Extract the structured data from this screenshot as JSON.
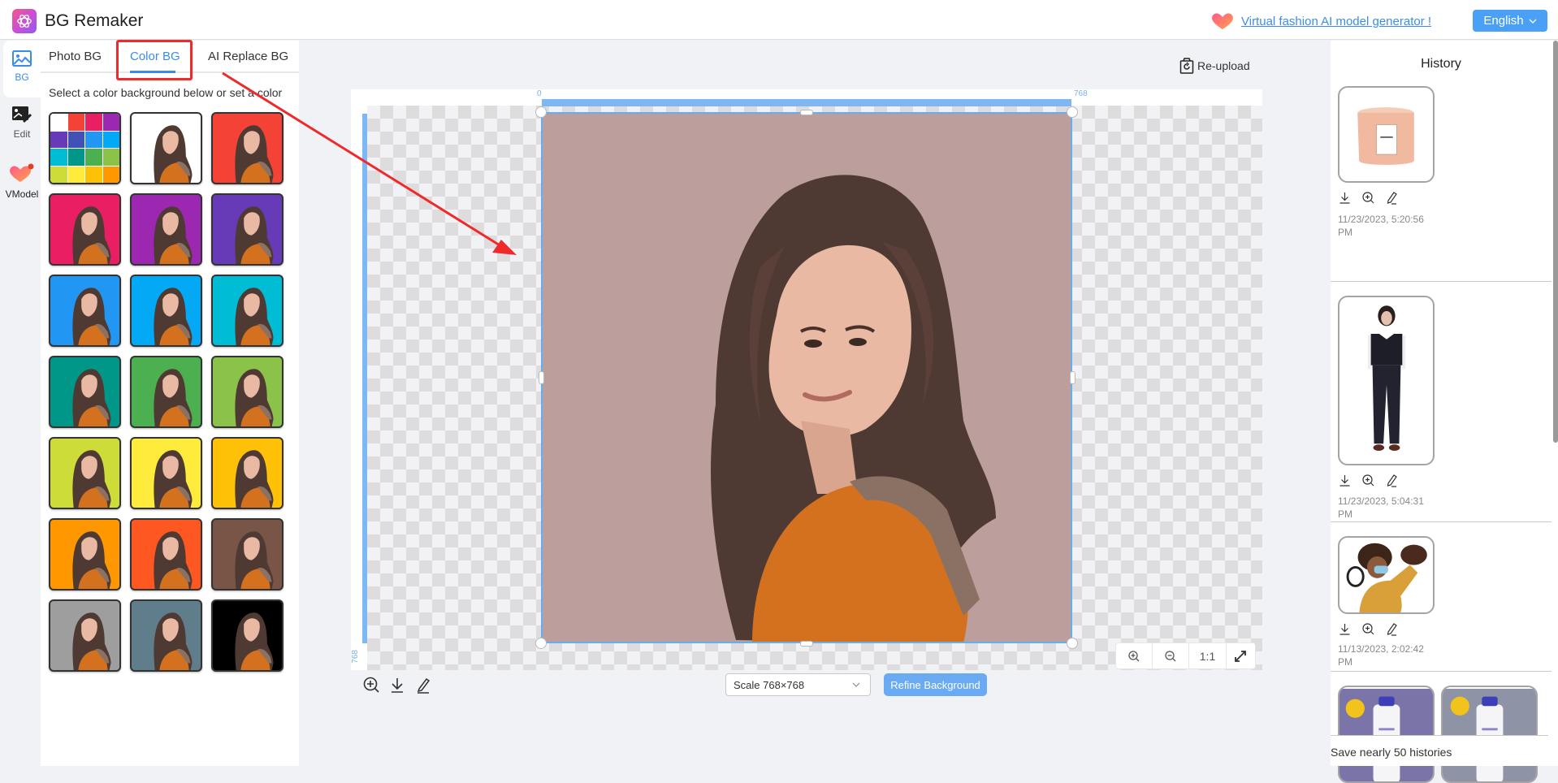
{
  "app": {
    "title": "BG Remaker",
    "logo_icon": "openai-swirl-icon"
  },
  "header": {
    "promo_icon": "heart-icon",
    "promo_link": "Virtual fashion AI model generator !",
    "language": "English"
  },
  "rail": {
    "items": [
      {
        "label": "BG",
        "icon": "image-icon",
        "active": true
      },
      {
        "label": "Edit",
        "icon": "image-edit-icon",
        "active": false
      },
      {
        "label": "VModel",
        "icon": "heart-badge-icon",
        "active": false
      }
    ]
  },
  "left_panel": {
    "tabs": [
      {
        "label": "Photo BG",
        "active": false
      },
      {
        "label": "Color BG",
        "active": true
      },
      {
        "label": "AI Replace BG",
        "active": false
      }
    ],
    "hint": "Select a color background below or set a color",
    "palette_colors": [
      "#ffffff",
      "#f44336",
      "#e91e63",
      "#9c27b0",
      "#673ab7",
      "#3f51b5",
      "#2196f3",
      "#03a9f4",
      "#00bcd4",
      "#009688",
      "#4caf50",
      "#8bc34a",
      "#cddc39",
      "#ffeb3b",
      "#ffc107",
      "#ff9800"
    ],
    "swatches": [
      {
        "name": "custom-palette"
      },
      {
        "name": "white",
        "color": "#ffffff"
      },
      {
        "name": "red",
        "color": "#f44336"
      },
      {
        "name": "pink",
        "color": "#e91e63"
      },
      {
        "name": "purple",
        "color": "#9c27b0"
      },
      {
        "name": "deep-purple",
        "color": "#673ab7"
      },
      {
        "name": "blue",
        "color": "#2196f3"
      },
      {
        "name": "light-blue",
        "color": "#03a9f4"
      },
      {
        "name": "cyan",
        "color": "#00bcd4"
      },
      {
        "name": "teal",
        "color": "#009688"
      },
      {
        "name": "green",
        "color": "#4caf50"
      },
      {
        "name": "light-green",
        "color": "#8bc34a"
      },
      {
        "name": "lime",
        "color": "#cddc39"
      },
      {
        "name": "yellow",
        "color": "#ffeb3b"
      },
      {
        "name": "amber",
        "color": "#ffc107"
      },
      {
        "name": "orange",
        "color": "#ff9800"
      },
      {
        "name": "deep-orange",
        "color": "#ff5722"
      },
      {
        "name": "brown",
        "color": "#795548"
      },
      {
        "name": "grey",
        "color": "#9e9e9e"
      },
      {
        "name": "blue-grey",
        "color": "#607d8b"
      },
      {
        "name": "black",
        "color": "#000000"
      }
    ]
  },
  "canvas": {
    "reupload_label": "Re-upload",
    "ruler_start": "0",
    "ruler_end_x": "768",
    "ruler_end_y": "768",
    "background_color": "#bc9e9d",
    "zoom_controls": {
      "zoom_in": "zoom-in-icon",
      "zoom_out": "zoom-out-icon",
      "actual": "1:1",
      "fit": "expand-icon"
    },
    "scale_select": "Scale 768×768",
    "refine_button": "Refine Background"
  },
  "history": {
    "title": "History",
    "items": [
      {
        "subject": "candle",
        "date": "11/23/2023, 5:20:56 PM"
      },
      {
        "subject": "fashion-model",
        "date": "11/23/2023, 5:04:31 PM"
      },
      {
        "subject": "megaphone-woman",
        "date": "11/13/2023, 2:02:42 PM"
      },
      {
        "subject": "toner-bottle-flowers",
        "date": ""
      }
    ],
    "footer": "Save nearly 50 histories"
  }
}
